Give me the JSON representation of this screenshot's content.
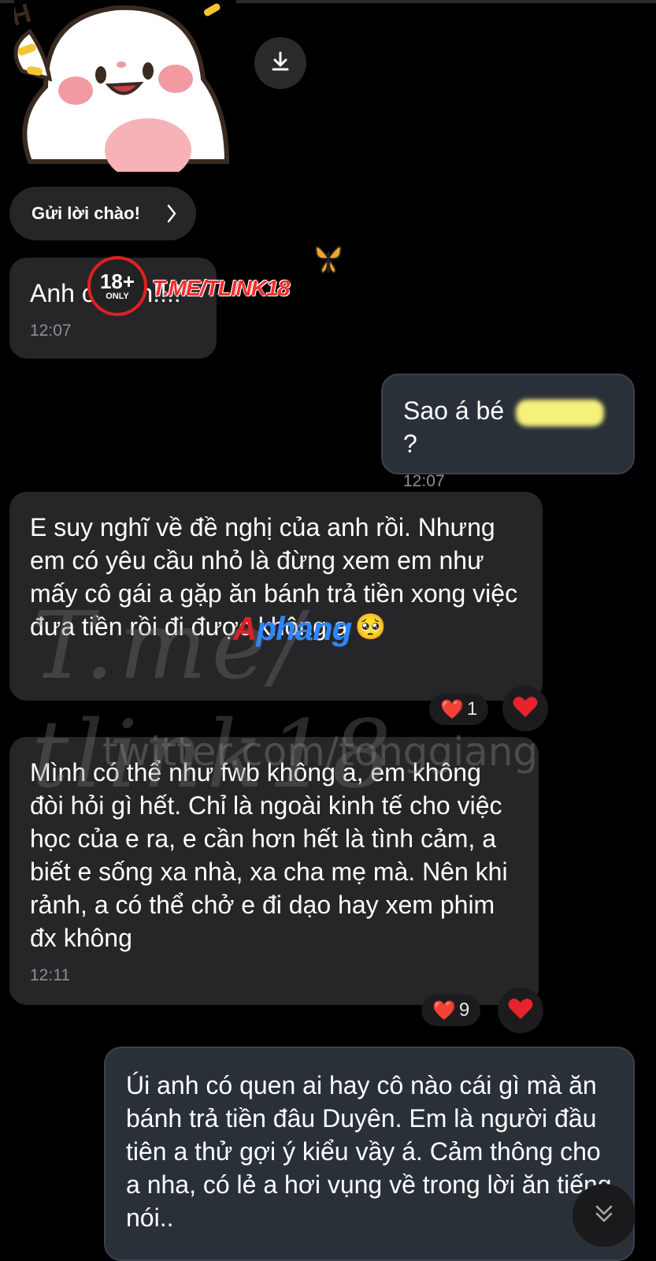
{
  "greet_button": {
    "label": "Gửi lời chào!"
  },
  "messages": [
    {
      "direction": "incoming",
      "text": "Anh ơi anh!!!!",
      "time": "12:07"
    },
    {
      "direction": "outgoing",
      "text_before": "Sao á bé ",
      "text_after": "?",
      "time": "12:07"
    },
    {
      "direction": "incoming",
      "text": "E suy nghĩ về đề nghị của anh rồi. Nhưng em có yêu cầu nhỏ là đừng xem em như mấy cô gái a gặp ăn bánh trả tiền xong việc đưa tiền rồi đi được không a 🥺",
      "reaction": {
        "emoji": "❤️",
        "count": "1"
      }
    },
    {
      "direction": "incoming",
      "text": "Mình có thể như fwb không a, em không đòi hỏi gì hết. Chỉ là ngoài kinh tế cho việc học của e ra, e cần hơn hết là tình cảm, a biết e sống xa nhà, xa cha mẹ mà. Nên khi rảnh, a có thể chở e đi dạo hay xem phim đx không",
      "time": "12:11",
      "reaction": {
        "emoji": "❤️",
        "count": "9"
      }
    },
    {
      "direction": "outgoing",
      "text": "Úi anh có quen ai hay cô nào cái gì mà ăn bánh trả tiền đâu Duyên. Em là người đầu tiên a thử gợi ý kiểu vầy á. Cảm thông cho a nha, có lẻ a hơi vụng về trong lời ăn tiếng nói.."
    }
  ],
  "overlays": {
    "badge_big": "18+",
    "badge_small": "ONLY",
    "tlink": "T.ME/TLINK18",
    "watermark_1": "T.me/ tlink18",
    "watermark_2": "twitter.com/tonggiang",
    "aphang_a": "A",
    "aphang_rest": "phang"
  },
  "colors": {
    "background": "#000000",
    "incoming_bubble": "#262628",
    "outgoing_bubble": "#2a3038",
    "timestamp": "#8e8e92",
    "heart": "#e8232e"
  }
}
